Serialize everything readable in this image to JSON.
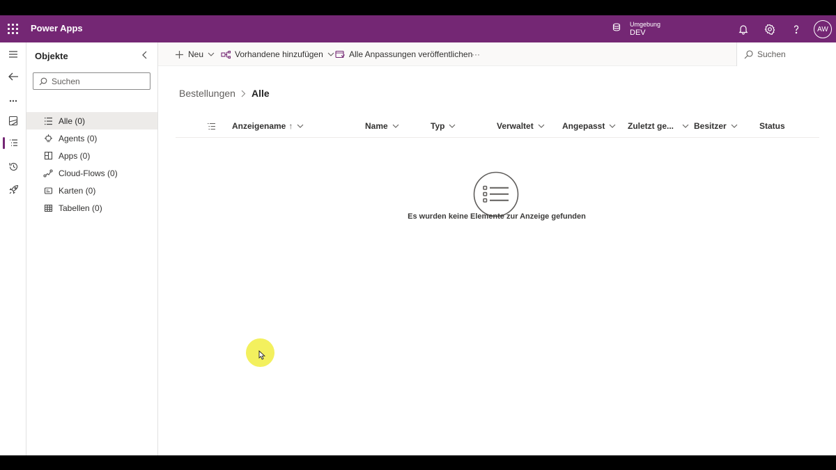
{
  "header": {
    "app_title": "Power Apps",
    "environment_label": "Umgebung",
    "environment_value": "DEV",
    "avatar_initials": "AW",
    "brand_color": "#742774"
  },
  "rail": {
    "items": [
      "menu-icon",
      "back-icon",
      "more-icon",
      "solutions-icon",
      "objects-icon",
      "history-icon",
      "pipelines-icon"
    ]
  },
  "objects_pane": {
    "title": "Objekte",
    "search_placeholder": "Suchen",
    "items": [
      {
        "label": "Alle (0)",
        "icon": "list-icon"
      },
      {
        "label": "Agents (0)",
        "icon": "agent-icon"
      },
      {
        "label": "Apps (0)",
        "icon": "apps-icon"
      },
      {
        "label": "Cloud-Flows (0)",
        "icon": "flow-icon"
      },
      {
        "label": "Karten (0)",
        "icon": "card-icon"
      },
      {
        "label": "Tabellen (0)",
        "icon": "table-icon"
      }
    ]
  },
  "command_bar": {
    "new_label": "Neu",
    "add_existing_label": "Vorhandene hinzufügen",
    "publish_label": "Alle Anpassungen veröffentlichen",
    "more_label": "···",
    "search_placeholder": "Suchen"
  },
  "breadcrumb": {
    "parent": "Bestellungen",
    "current": "Alle"
  },
  "grid": {
    "columns": [
      {
        "label": "Anzeigename",
        "sort": "↑"
      },
      {
        "label": "Name"
      },
      {
        "label": "Typ"
      },
      {
        "label": "Verwaltet"
      },
      {
        "label": "Angepasst"
      },
      {
        "label": "Zuletzt ge..."
      },
      {
        "label": "Besitzer"
      },
      {
        "label": "Status"
      }
    ],
    "empty_message": "Es wurden keine Elemente zur Anzeige gefunden"
  }
}
